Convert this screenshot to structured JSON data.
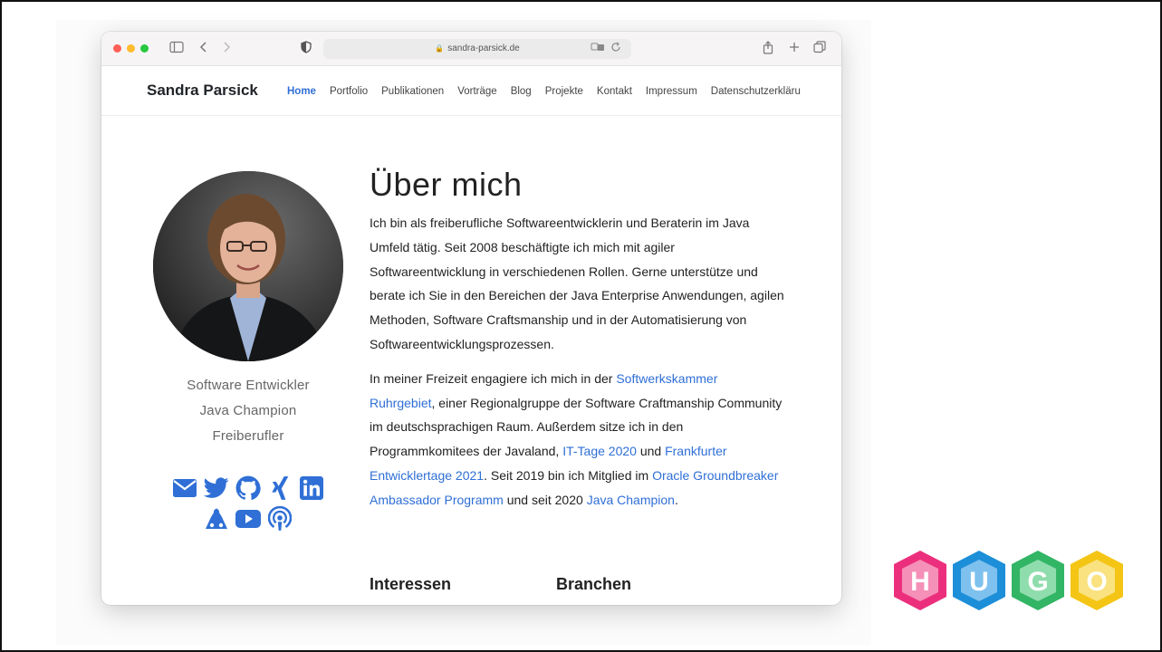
{
  "browser": {
    "url": "sandra-parsick.de"
  },
  "site": {
    "brand": "Sandra Parsick",
    "nav": [
      "Home",
      "Portfolio",
      "Publikationen",
      "Vorträge",
      "Blog",
      "Projekte",
      "Kontakt",
      "Impressum",
      "Datenschutzerkläru"
    ],
    "active_nav": "Home"
  },
  "profile": {
    "roles": [
      "Software Entwickler",
      "Java Champion",
      "Freiberufler"
    ],
    "social_row1": [
      "mail-icon",
      "twitter-icon",
      "github-icon",
      "xing-icon",
      "linkedin-icon"
    ],
    "social_row2": [
      "speakerdeck-icon",
      "youtube-icon",
      "podcast-icon"
    ],
    "icon_color": "#2f6fd6"
  },
  "content": {
    "title": "Über mich",
    "para1": "Ich bin als freiberufliche Softwareentwicklerin und Beraterin im Java Umfeld tätig. Seit 2008 beschäftigte ich mich mit agiler Softwareentwicklung in verschiedenen Rollen. Gerne unterstütze und berate ich Sie in den Bereichen der Java Enterprise Anwendungen, agilen Methoden, Software Craftsmanship und in der Automatisierung von Softwareentwicklungsprozessen.",
    "para2": {
      "t1": "In meiner Freizeit engagiere ich mich in der ",
      "l1": "Softwerkskammer Ruhrgebiet",
      "t2": ", einer Regionalgruppe der Software Craftmanship Community im deutschsprachigen Raum. Außerdem sitze ich in den Programmkomitees der Javaland, ",
      "l2": "IT-Tage 2020",
      "t3": " und ",
      "l3": "Frankfurter Entwicklertage 2021",
      "t4": ". Seit 2019 bin ich Mitglied im ",
      "l4": "Oracle Groundbreaker Ambassador Programm",
      "t5": " und seit 2020 ",
      "l5": "Java Champion",
      "t6": "."
    },
    "section1": "Interessen",
    "section2": "Branchen"
  },
  "hugo_logo": {
    "letters": [
      "H",
      "U",
      "G",
      "O"
    ],
    "colors": [
      "#ec2f7d",
      "#1d8ed8",
      "#32b565",
      "#f4c514"
    ]
  }
}
